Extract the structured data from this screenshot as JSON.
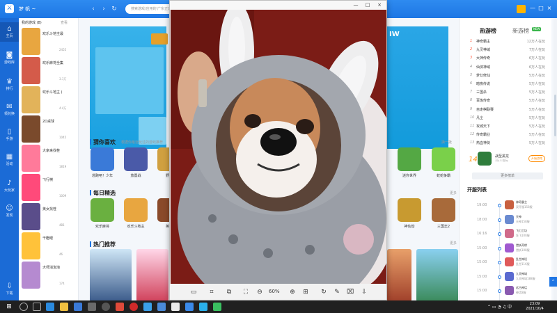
{
  "app": {
    "title": "梦 帆 ~",
    "search_placeholder": "搜索游戏/应用的'广东正式上'"
  },
  "window_controls": {
    "minimize": "—",
    "maximize": "□",
    "close": "×"
  },
  "sidebar": {
    "items": [
      {
        "icon": "home-icon",
        "glyph": "⌂",
        "label": "主页"
      },
      {
        "icon": "gamepad-icon",
        "glyph": "◙",
        "label": "游戏库"
      },
      {
        "icon": "trophy-icon",
        "glyph": "♛",
        "label": "排行"
      },
      {
        "icon": "gift-icon",
        "glyph": "✉",
        "label": "领兑换"
      },
      {
        "icon": "phone-icon",
        "glyph": "▯",
        "label": "手游"
      },
      {
        "icon": "calendar-icon",
        "glyph": "▦",
        "label": "活动"
      },
      {
        "icon": "mic-icon",
        "glyph": "♪",
        "label": "大玩家"
      },
      {
        "icon": "person-icon",
        "glyph": "☺",
        "label": "发现"
      },
      {
        "icon": "download-icon",
        "glyph": "⇩",
        "label": "下载"
      }
    ]
  },
  "recent": {
    "heading": "我的游戏 (8)",
    "more": "查看",
    "games": [
      {
        "name": "欢乐斗地主最",
        "count": "2455",
        "color": "#e8a640"
      },
      {
        "name": "欢乐麻将全集",
        "count": "3.1万",
        "color": "#d45b4a"
      },
      {
        "name": "欢乐斗地主 (",
        "count": "4.4万",
        "color": "#e2b35a"
      },
      {
        "name": "2D桌球",
        "count": "1045",
        "color": "#7a4a2c"
      },
      {
        "name": "大家来找茬",
        "count": "1819",
        "color": "#ff7a9a"
      },
      {
        "name": "飞行棋",
        "count": "1009",
        "color": "#ff4a7a"
      },
      {
        "name": "美女找茬",
        "count": "481",
        "color": "#5a4d8a"
      },
      {
        "name": "干瞪眼",
        "count": "46",
        "color": "#ffc23a"
      },
      {
        "name": "大师消泡泡",
        "count": "174",
        "color": "#b58ad0"
      }
    ]
  },
  "main": {
    "banner_right_title": "IW",
    "guess": {
      "title": "猜你喜欢",
      "sub": "根据你最近玩过的游戏推荐",
      "more": "换一批",
      "games": [
        {
          "name": "逃跑吧！少年",
          "color": "#3a7ad8"
        },
        {
          "name": "放置战",
          "color": "#4a5aa8"
        },
        {
          "name": "野王",
          "color": "#d0a040"
        },
        {
          "name": "迷你世界",
          "color": "#54a844"
        },
        {
          "name": "蛇蛇争霸",
          "color": "#7ad04a"
        }
      ]
    },
    "daily": {
      "title": "每日精选",
      "more": "更多",
      "games": [
        {
          "name": "欢乐麻将",
          "color": "#6ab040"
        },
        {
          "name": "欢乐斗地主",
          "color": "#e8a640"
        },
        {
          "name": "英雄",
          "color": "#8a4a2a"
        },
        {
          "name": "神仙劫",
          "color": "#c89a30"
        },
        {
          "name": "三国志2",
          "color": "#a86a3a"
        }
      ]
    },
    "hot": {
      "title": "热门推荐",
      "more": "更多"
    }
  },
  "rank": {
    "tabs": [
      "热游榜",
      "新游榜"
    ],
    "new_badge": "NEW",
    "rows": [
      {
        "no": "1",
        "name": "神奇霸主",
        "count": "12万人在玩"
      },
      {
        "no": "2",
        "name": "九灵神域",
        "count": "7万人在玩"
      },
      {
        "no": "3",
        "name": "大神传奇",
        "count": "6万人在玩"
      },
      {
        "no": "4",
        "name": "仙侠神域",
        "count": "6万人在玩"
      },
      {
        "no": "5",
        "name": "梦幻修仙",
        "count": "5万人在玩"
      },
      {
        "no": "6",
        "name": "暗夜传说",
        "count": "5万人在玩"
      },
      {
        "no": "7",
        "name": "三国杀",
        "count": "5万人在玩"
      },
      {
        "no": "8",
        "name": "百炼传奇",
        "count": "5万人在玩"
      },
      {
        "no": "9",
        "name": "自走棋联赛",
        "count": "5万人在玩"
      },
      {
        "no": "10",
        "name": "凡尘",
        "count": "5万人在玩"
      },
      {
        "no": "11",
        "name": "攻城天下",
        "count": "5万人在玩"
      },
      {
        "no": "12",
        "name": "传奇霸业",
        "count": "5万人在玩"
      },
      {
        "no": "13",
        "name": "热血神剑",
        "count": "5万人在玩"
      }
    ],
    "featured": {
      "no": "14",
      "name": "战至黑龙",
      "count": "3万人在玩",
      "button": "开始游戏"
    },
    "more": "更多榜单"
  },
  "schedule": {
    "title": "开服列表",
    "rows": [
      {
        "time": "19:00",
        "name": "神奇霸主",
        "server": "双开服158服",
        "color": "#c86040"
      },
      {
        "time": "18:00",
        "name": "天神",
        "server": "天神158服",
        "color": "#6a8ad0"
      },
      {
        "time": "16:16",
        "name": "飞刀工坊",
        "server": "狂飞100服",
        "color": "#d06a8a"
      },
      {
        "time": "15:00",
        "name": "猎妖奇缘",
        "server": "猎妖108服",
        "color": "#a05ad0"
      },
      {
        "time": "15:00",
        "name": "乱世神话",
        "server": "乱世116服",
        "color": "#e05a5a"
      },
      {
        "time": "15:00",
        "name": "九灵神域",
        "server": "九灵神域188服",
        "color": "#5a6ad0"
      },
      {
        "time": "15:00",
        "name": "远古神话",
        "server": "神话8服",
        "color": "#8a5ab0"
      }
    ]
  },
  "viewer": {
    "zoom": "60%",
    "tools": [
      "fit-icon",
      "crop-icon",
      "compare-icon",
      "fullscreen-icon",
      "zoom-out-icon",
      "zoom-in-icon",
      "original-size-icon",
      "rotate-icon",
      "edit-icon",
      "cut-icon",
      "save-icon"
    ]
  },
  "taskbar": {
    "time": "23:09",
    "date": "2021/10/4"
  }
}
